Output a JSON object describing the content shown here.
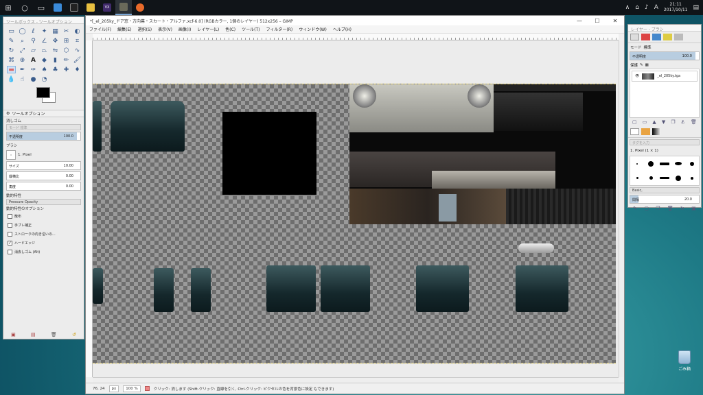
{
  "taskbar": {
    "icons": [
      "windows-start-icon",
      "search-icon",
      "task-view-icon",
      "app-icon-1",
      "terminal-icon",
      "explorer-icon",
      "vx-icon",
      "gimp-icon",
      "firefox-icon"
    ],
    "vx_label": "VX",
    "clock_time": "21:11",
    "clock_date": "2017/10/11",
    "ime": "A"
  },
  "toolbox": {
    "title": "ツールボックス - ツールオプション",
    "tab_label": "ツールオプション",
    "tool_name": "消しゴム",
    "mode_label": "モード",
    "mode_value": "標準",
    "opacity_label": "不透明度",
    "opacity_value": "100.0",
    "brush_label": "ブラシ",
    "brush_value": "1. Pixel",
    "size_label": "サイズ",
    "size_value": "10.00",
    "aspect_label": "縦横比",
    "aspect_value": "0.00",
    "angle_label": "角度",
    "angle_value": "0.00",
    "dynamics_label": "動的特性",
    "dynamics_value": "Pressure Opacity",
    "dynamics_options": "動的特性のオプション",
    "checks": [
      {
        "label": "散布",
        "checked": false
      },
      {
        "label": "手ブレ補正",
        "checked": false
      },
      {
        "label": "ストロークの向き沿いの...",
        "checked": false
      },
      {
        "label": "ハードエッジ",
        "checked": true
      },
      {
        "label": "消去しゴム (Alt)",
        "checked": false
      }
    ]
  },
  "mainwin": {
    "title": "*[_el_205ky_ドア窓・方向幕・スカート・アルファ.xcf-6.0] (RGBカラー, 1個のレイヤー) 512x256 – GIMP",
    "minimize": "—",
    "maximize": "☐",
    "close": "✕",
    "menus": [
      "ファイル(F)",
      "編集(E)",
      "選択(S)",
      "表示(V)",
      "画像(I)",
      "レイヤー(L)",
      "色(C)",
      "ツール(T)",
      "フィルター(R)",
      "ウィンドウ(W)",
      "ヘルプ(H)"
    ],
    "status": {
      "coords": "76, 24",
      "unit": "px",
      "zoom": "100 %",
      "hint": "クリック: 消します (Shift-クリック: 直線を引く, Ctrl-クリック: ピクセルの色を背景色に設定 もできます)"
    }
  },
  "layers": {
    "title": "レイヤー - ブラシ",
    "mode_label": "モード",
    "mode_value": "標準",
    "opacity_label": "不透明度",
    "opacity_value": "100.0",
    "lock_label": "保護",
    "layer_name": "_el_205ky.tga",
    "brush_tag": "タグを入力",
    "brush_name": "1. Pixel (1 × 1)",
    "brush_set": "Basic,",
    "spacing_label": "間隔",
    "spacing_value": "20.0"
  },
  "desktop": {
    "recycle_bin": "ごみ箱"
  },
  "colors": {
    "fg": "#000000",
    "bg": "#ffffff"
  }
}
